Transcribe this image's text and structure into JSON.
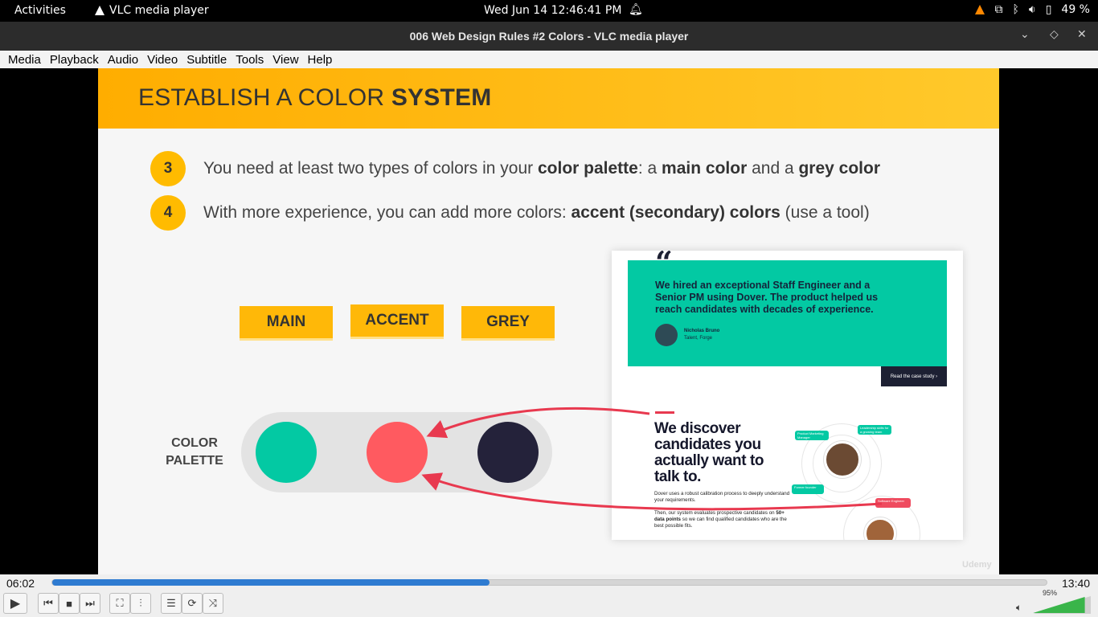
{
  "topbar": {
    "activities": "Activities",
    "app_name": "VLC media player",
    "clock": "Wed Jun 14  12:46:41 PM",
    "battery": "49 %"
  },
  "window": {
    "title": "006 Web Design Rules #2 Colors - VLC media player"
  },
  "menu": [
    "Media",
    "Playback",
    "Audio",
    "Video",
    "Subtitle",
    "Tools",
    "View",
    "Help"
  ],
  "slide": {
    "title_normal": "ESTABLISH A COLOR ",
    "title_bold": "SYSTEM",
    "points": [
      {
        "num": "3",
        "parts": [
          {
            "t": "You need at least two types of colors in your ",
            "b": false
          },
          {
            "t": "color palette",
            "b": true
          },
          {
            "t": ": a ",
            "b": false
          },
          {
            "t": "main color",
            "b": true
          },
          {
            "t": " and a ",
            "b": false
          },
          {
            "t": "grey color",
            "b": true
          }
        ]
      },
      {
        "num": "4",
        "parts": [
          {
            "t": "With more experience, you can add more colors: ",
            "b": false
          },
          {
            "t": "accent (secondary) colors",
            "b": true
          },
          {
            "t": " (use a tool)",
            "b": false
          }
        ]
      }
    ],
    "tags": [
      "MAIN",
      "ACCENT",
      "GREY"
    ],
    "palette_label_1": "COLOR",
    "palette_label_2": "PALETTE",
    "palette_colors": {
      "main": "#03c9a3",
      "accent": "#ff5a60",
      "grey": "#24223a"
    },
    "watermark": "Udemy"
  },
  "card": {
    "quote_mark": "“",
    "testimonial": "We hired an exceptional Staff Engineer and a Senior PM using Dover. The product helped us reach candidates with decades of experience.",
    "person_name": "Nicholas Bruno",
    "person_role": "Talent, Forge",
    "case_study": "Read the case study ›",
    "headline": "We discover candidates you actually want to talk to.",
    "para1": "Dover uses a robust calibration process to deeply understand your requirements.",
    "para2_a": "Then, our system evaluates prospective candidates on ",
    "para2_b": "50+ data points",
    "para2_c": " so we can find qualified candidates who are the best possible fits.",
    "bubbles": [
      "Product Marketing Manager",
      "Leadership skills for a growing team",
      "Former founder",
      "Software Engineer"
    ]
  },
  "player": {
    "elapsed": "06:02",
    "total": "13:40",
    "progress": 0.44,
    "volume": "95%"
  }
}
